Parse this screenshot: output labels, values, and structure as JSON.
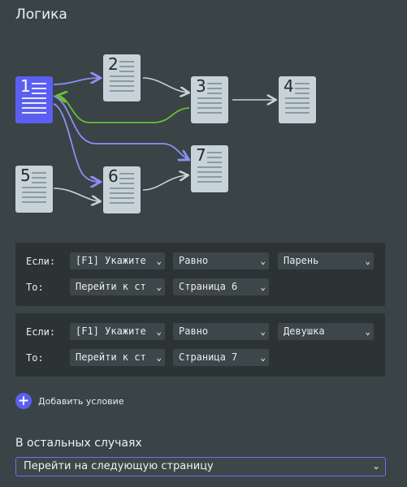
{
  "title": "Логика",
  "pages": [
    "1",
    "2",
    "3",
    "4",
    "5",
    "6",
    "7"
  ],
  "conditions": [
    {
      "if_label": "Если:",
      "then_label": "То:",
      "field": "[F1] Укажите",
      "operator": "Равно",
      "value": "Парень",
      "action": "Перейти к ст",
      "target": "Страница 6"
    },
    {
      "if_label": "Если:",
      "then_label": "То:",
      "field": "[F1] Укажите",
      "operator": "Равно",
      "value": "Девушка",
      "action": "Перейти к ст",
      "target": "Страница 7"
    }
  ],
  "add_condition_label": "Добавить условие",
  "else_section": {
    "title": "В остальных случаях",
    "selected": "Перейти на следующую страницу"
  },
  "colors": {
    "background": "#3a4346",
    "accent": "#5b5ff1",
    "arrow_blue": "#8c90f5",
    "arrow_green": "#6cbf34",
    "arrow_gray": "#c7d3d8"
  }
}
